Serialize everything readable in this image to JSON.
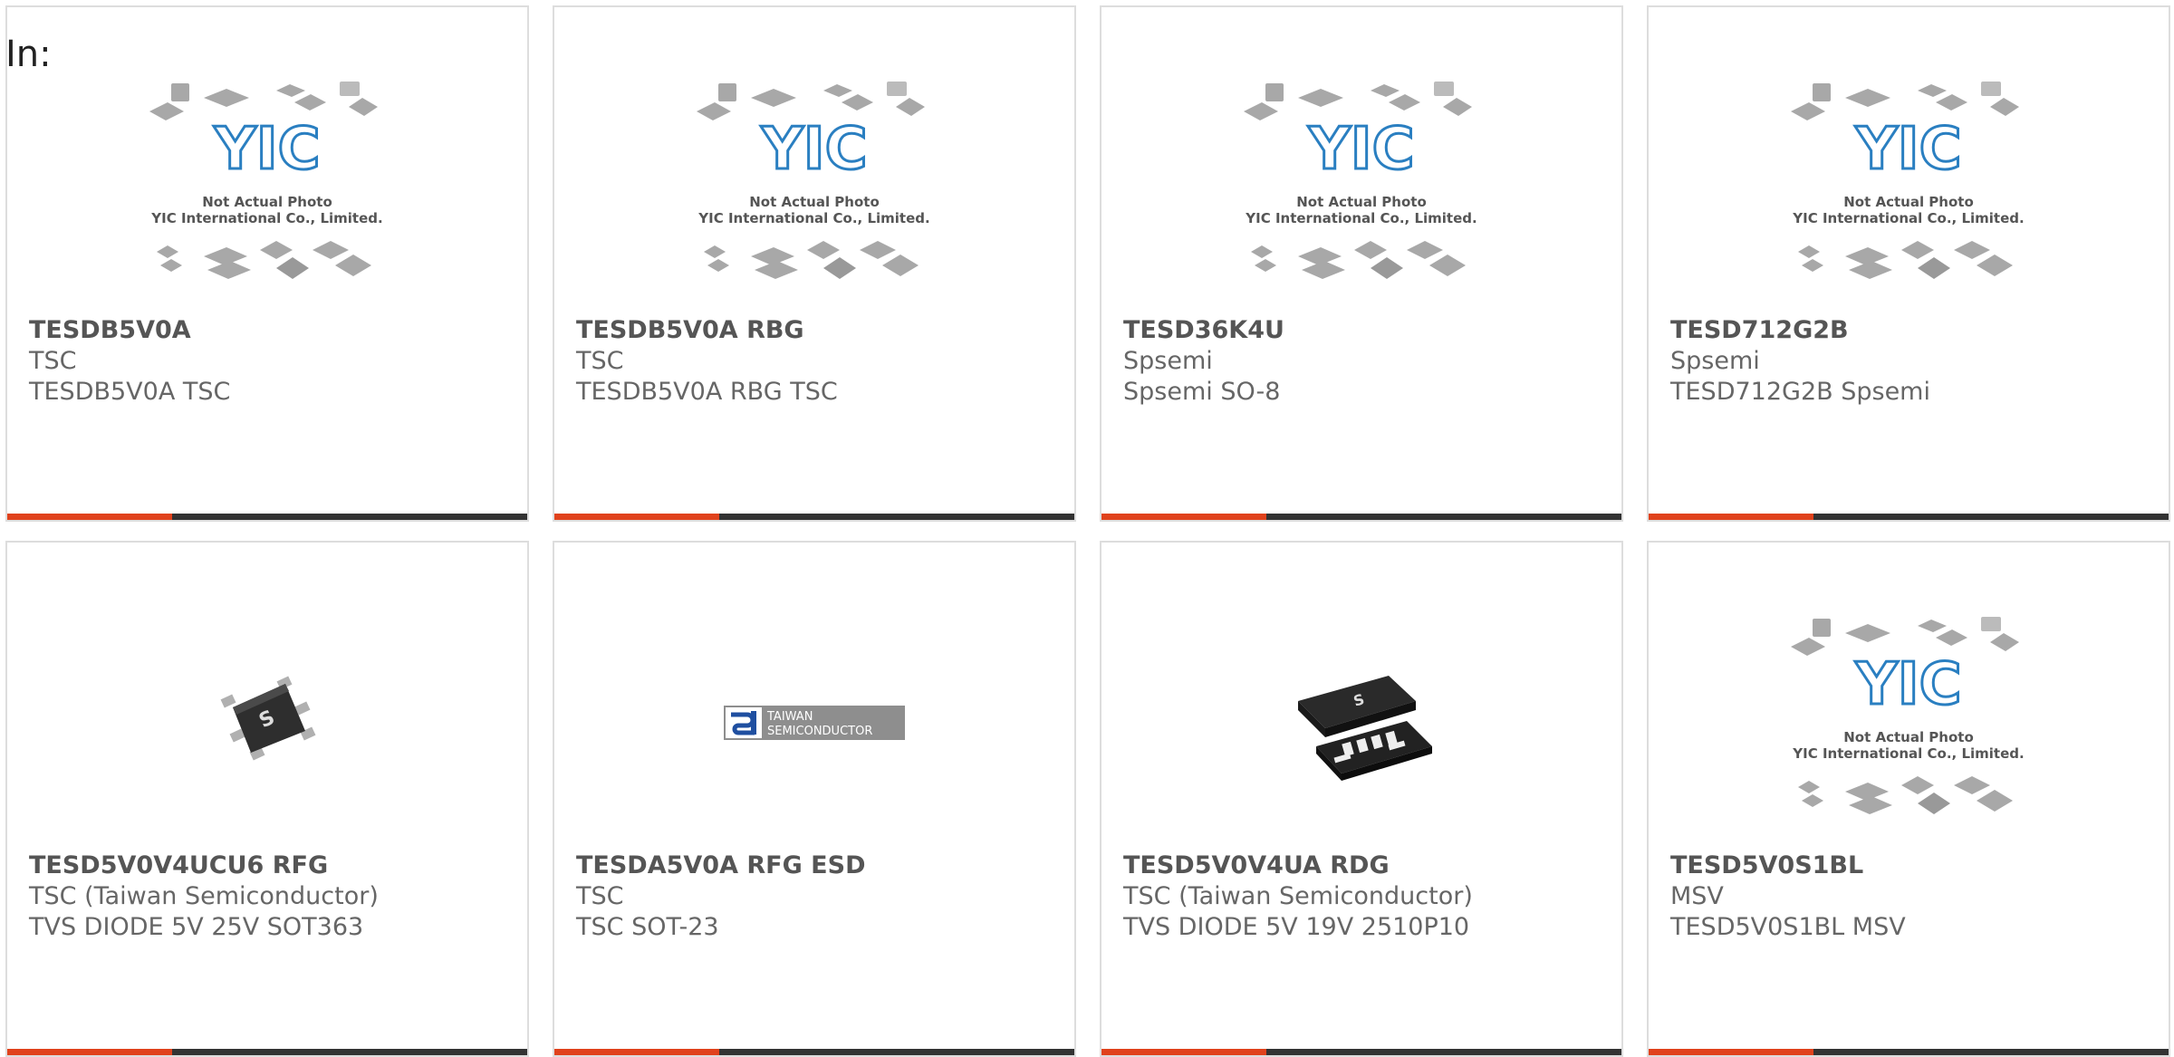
{
  "search": {
    "in_label": "In:"
  },
  "colors": {
    "accent": "#e0421c",
    "bar": "#333333",
    "border": "#dddddd",
    "logo_blue": "#2a7fc1"
  },
  "placeholder": {
    "line1": "Not Actual Photo",
    "line2": "YIC International Co., Limited.",
    "logo_text": "YIC"
  },
  "tsc_logo": {
    "line1": "TAIWAN",
    "line2": "SEMICONDUCTOR"
  },
  "products": [
    {
      "part_number": "TESDB5V0A",
      "manufacturer": "TSC",
      "description": "TESDB5V0A TSC",
      "image": "placeholder"
    },
    {
      "part_number": "TESDB5V0A RBG",
      "manufacturer": "TSC",
      "description": "TESDB5V0A RBG TSC",
      "image": "placeholder"
    },
    {
      "part_number": "TESD36K4U",
      "manufacturer": "Spsemi",
      "description": "Spsemi SO-8",
      "image": "placeholder"
    },
    {
      "part_number": "TESD712G2B",
      "manufacturer": "Spsemi",
      "description": "TESD712G2B Spsemi",
      "image": "placeholder"
    },
    {
      "part_number": "TESD5V0V4UCU6 RFG",
      "manufacturer": "TSC (Taiwan Semiconductor)",
      "description": "TVS DIODE 5V 25V SOT363",
      "image": "sot363-chip"
    },
    {
      "part_number": "TESDA5V0A RFG ESD",
      "manufacturer": "TSC",
      "description": "TSC SOT-23",
      "image": "tsc-logo"
    },
    {
      "part_number": "TESD5V0V4UA RDG",
      "manufacturer": "TSC (Taiwan Semiconductor)",
      "description": "TVS DIODE 5V 19V 2510P10",
      "image": "dfn-chip"
    },
    {
      "part_number": "TESD5V0S1BL",
      "manufacturer": "MSV",
      "description": "TESD5V0S1BL MSV",
      "image": "placeholder"
    }
  ]
}
